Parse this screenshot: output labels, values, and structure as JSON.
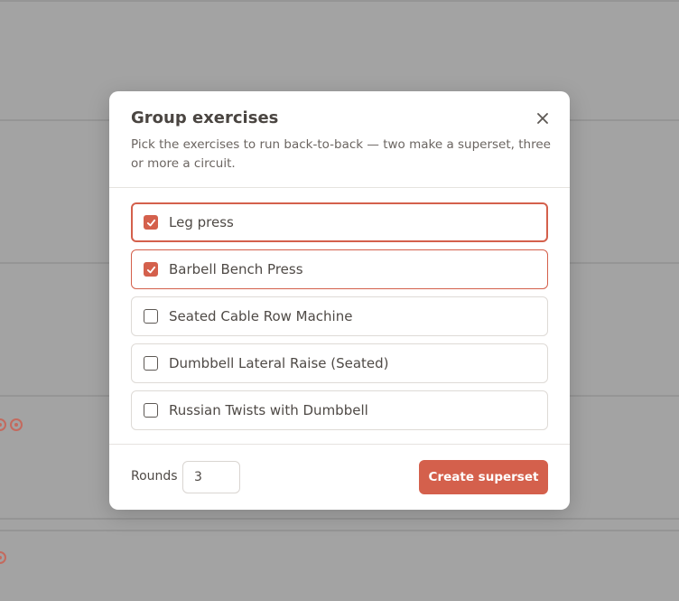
{
  "modal": {
    "title": "Group exercises",
    "description": "Pick the exercises to run back-to-back — two make a superset, three or more a circuit.",
    "close_icon": "close-icon",
    "exercises": [
      {
        "label": "Leg press",
        "checked": true
      },
      {
        "label": "Barbell Bench Press",
        "checked": true
      },
      {
        "label": "Seated Cable Row Machine",
        "checked": false
      },
      {
        "label": "Dumbbell Lateral Raise (Seated)",
        "checked": false
      },
      {
        "label": "Russian Twists with Dumbbell",
        "checked": false
      }
    ],
    "footer": {
      "rounds_label": "Rounds",
      "rounds_value": "3",
      "create_button": "Create superset"
    }
  },
  "colors": {
    "accent": "#d4604c",
    "overlay": "#a3a3a3",
    "text": "#4f4a46"
  }
}
